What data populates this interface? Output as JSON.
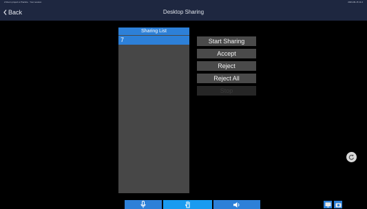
{
  "status_bar": {
    "left_text": "2 Room project ● Practice · Your session",
    "right_text": "2023-09-15 11:2"
  },
  "nav": {
    "back_label": "Back",
    "title": "Desktop Sharing"
  },
  "sharing_list": {
    "header": "Sharing List",
    "items": [
      "7"
    ]
  },
  "actions": {
    "start_sharing": "Start Sharing",
    "accept": "Accept",
    "reject": "Reject",
    "reject_all": "Reject All",
    "stop": "Stop"
  },
  "icons": {
    "back": "chevron-left-icon",
    "float": "rotate-icon",
    "mic": "microphone-icon",
    "hand": "raise-hand-icon",
    "speaker": "speaker-icon",
    "screen": "screen-icon",
    "camera": "camera-icon"
  },
  "colors": {
    "bar": "#1e2740",
    "accent": "#2d80d8",
    "panel": "#474747",
    "button": "#4a4a4a"
  }
}
